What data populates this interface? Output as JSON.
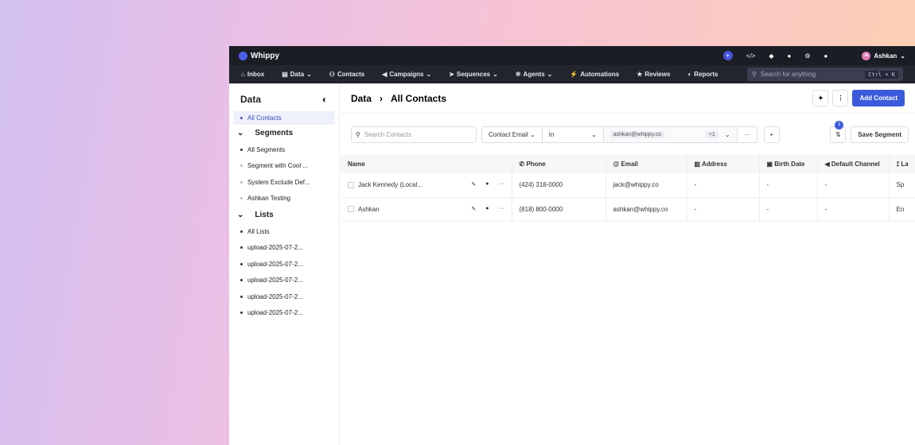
{
  "app": {
    "name": "Whippy",
    "user": "Ashkan",
    "user_initials": "AI"
  },
  "topicons": [
    "plus-icon",
    "code-icon",
    "megaphone-icon",
    "help-icon",
    "settings-icon",
    "bell-icon"
  ],
  "nav": [
    {
      "label": "Inbox",
      "icon": "⌂"
    },
    {
      "label": "Data",
      "icon": "▤",
      "caret": true
    },
    {
      "label": "Contacts",
      "icon": "⚇"
    },
    {
      "label": "Campaigns",
      "icon": "◀",
      "caret": true
    },
    {
      "label": "Sequences",
      "icon": "➤",
      "caret": true
    },
    {
      "label": "Agents",
      "icon": "✲",
      "caret": true
    },
    {
      "label": "Automations",
      "icon": "⚡"
    },
    {
      "label": "Reviews",
      "icon": "★"
    },
    {
      "label": "Reports",
      "icon": "◐"
    }
  ],
  "search": {
    "placeholder": "Search for anything",
    "shortcut": "Ctrl + K"
  },
  "sidebar": {
    "title": "Data",
    "all_contacts": "All Contacts",
    "segments_title": "Segments",
    "segments": [
      "All Segments",
      "Segment with Cool ...",
      "System Exclude Def...",
      "Ashkan Testing"
    ],
    "lists_title": "Lists",
    "lists": [
      "All Lists",
      "upload-2025-07-2...",
      "upload-2025-07-2...",
      "upload-2025-07-2...",
      "upload-2025-07-2...",
      "upload-2025-07-2..."
    ]
  },
  "header": {
    "crumb": "Data",
    "title": "All Contacts",
    "add": "Add Contact"
  },
  "filters": {
    "search_placeholder": "Search Contacts",
    "field": "Contact Email",
    "op": "In",
    "value": "ashkan@whippy.co",
    "more": "+1",
    "sort_badge": "1",
    "save": "Save Segment"
  },
  "table": {
    "columns": [
      "Name",
      "Phone",
      "Email",
      "Address",
      "Birth Date",
      "Default Channel",
      "La"
    ],
    "rows": [
      [
        "Jack Kennedy (Local...",
        "(424) 318-0000",
        "jack@whippy.co",
        "-",
        "-",
        "-",
        "Sp"
      ],
      [
        "Ashkan",
        "(818) 800-0000",
        "ashkan@whippy.co",
        "-",
        "-",
        "-",
        "En"
      ]
    ]
  },
  "colors": {
    "accent": "#3b5bdb",
    "topbar": "#1b1d25"
  }
}
